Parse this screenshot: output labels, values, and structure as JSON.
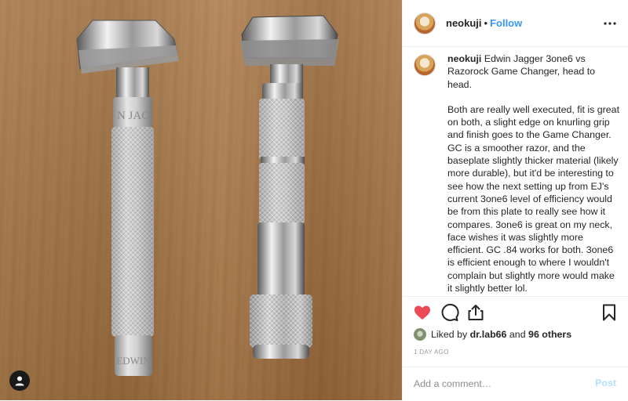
{
  "photo": {
    "left_razor_engraving_top": "N JAG",
    "left_razor_engraving_bottom": "EDWIN"
  },
  "header": {
    "username": "neokuji",
    "separator": "•",
    "follow_label": "Follow"
  },
  "caption": {
    "username": "neokuji",
    "first_line": "Edwin Jagger 3one6 vs Razorock Game Changer, head to head.",
    "body": "Both are really well executed, fit is great on both, a slight edge on knurling grip and finish goes to the Game Changer. GC is a smoother razor, and the baseplate slightly thicker material (likely more durable), but it'd be interesting to see how the next setting up from EJ's current 3one6 level of efficiency would be from this plate to really see how it compares. 3one6 is great on my neck, face wishes it was slightly more efficient. GC .84 works for both. 3one6 is efficient enough to where I wouldn't complain but slightly more would make it slightly better lol."
  },
  "likes": {
    "prefix": "Liked by",
    "user": "dr.lab66",
    "conjunction": "and",
    "others": "96 others"
  },
  "date": "1 DAY AGO",
  "comment": {
    "placeholder": "Add a comment…",
    "post_label": "Post"
  },
  "colors": {
    "accent": "#3897f0",
    "like_red": "#ed4956",
    "post_disabled": "#b2dffc",
    "muted": "#999999",
    "border": "#efefef"
  },
  "icons": [
    "user-tag-icon",
    "more-options-icon",
    "heart-icon",
    "comment-icon",
    "share-icon",
    "bookmark-icon"
  ]
}
